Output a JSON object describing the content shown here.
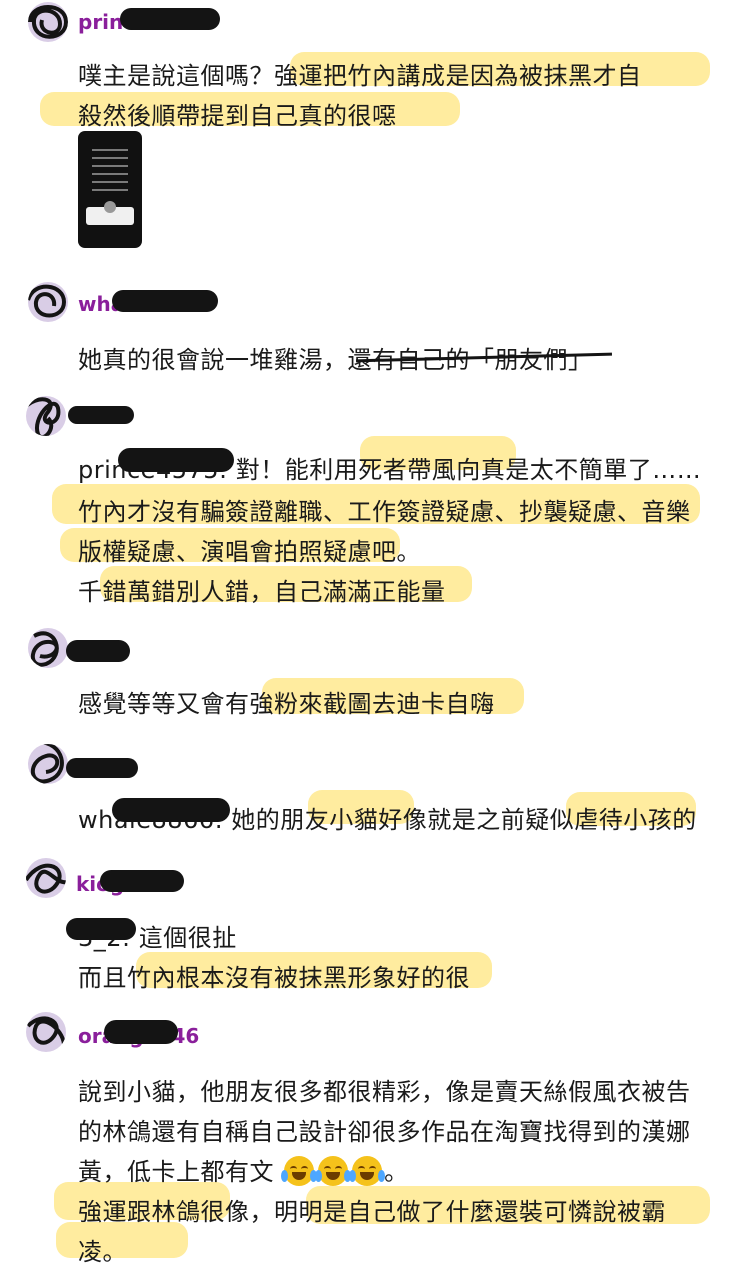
{
  "comments": [
    {
      "username": "prince4575",
      "lines": [
        "噗主是說這個嗎？強運把竹內講成是因為被抹黑才自",
        "殺然後順帶提到自己真的很噁"
      ],
      "has_screenshot": true
    },
    {
      "username": "whale8866",
      "lines": [
        "她真的很會說一堆雞湯，還有自己的「朋友們」"
      ]
    },
    {
      "username": "",
      "reply_to": "prince4575",
      "lines": [
        ": 對！能利用死者帶風向真是太不簡單了……",
        "竹內才沒有騙簽證離職、工作簽證疑慮、抄襲疑慮、音樂",
        "版權疑慮、演唱會拍照疑慮吧。",
        "千錯萬錯別人錯，自己滿滿正能量"
      ]
    },
    {
      "username": "",
      "lines": [
        "感覺等等又會有強粉來截圖去迪卡自嗨"
      ]
    },
    {
      "username": "",
      "reply_to": "whale8866",
      "lines": [
        ": 她的朋友小貓好像就是之前疑似虐待小孩的"
      ]
    },
    {
      "username": "kiog6130",
      "reply_to": "3_2",
      "lines": [
        ": 這個很扯",
        "而且竹內根本沒有被抹黑形象好的很"
      ]
    },
    {
      "username": "orang5546",
      "lines": [
        "說到小貓，他朋友很多都很精彩，像是賣天絲假風衣被告",
        "的林鴿還有自稱自己設計卻很多作品在淘寶找得到的漢娜",
        "黃，低卡上都有文",
        "強運跟林鴿很像，明明是自己做了什麼還裝可憐說被霸",
        "凌。"
      ],
      "emoji_line_suffix": "。",
      "emojis": [
        "joy-emoji",
        "joy-emoji",
        "joy-emoji"
      ]
    }
  ],
  "colors": {
    "username": "#8a1f9b",
    "highlight": "#ffdc50",
    "avatar_bg": "#d9cde6",
    "scribble": "#141414"
  }
}
